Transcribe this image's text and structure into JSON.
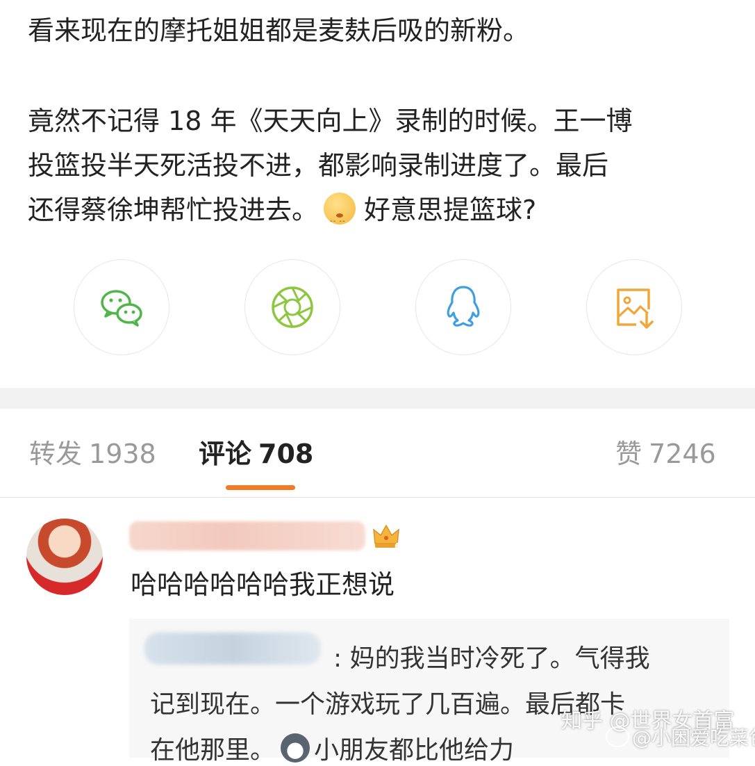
{
  "post": {
    "line1": "看来现在的摩托姐姐都是麦麸后吸的新粉。",
    "para2_line1": "竟然不记得 18 年《天天向上》录制的时候。王一博",
    "para2_line2": "投篮投半天死活投不进，都影响录制进度了。最后",
    "para2_line3_a": "还得蔡徐坤帮忙投进去。",
    "para2_line3_b": "好意思提篮球?"
  },
  "share_buttons": [
    {
      "icon": "wechat-icon",
      "color": "#4cb648"
    },
    {
      "icon": "moments-icon",
      "color": "#8dc63f"
    },
    {
      "icon": "qq-icon",
      "color": "#3d9fe0"
    },
    {
      "icon": "save-image-icon",
      "color": "#f0a73a"
    }
  ],
  "tabs": {
    "repost_label": "转发",
    "repost_count": "1938",
    "comment_label": "评论",
    "comment_count": "708",
    "like_label": "赞",
    "like_count": "7246"
  },
  "comment": {
    "text": "哈哈哈哈哈哈我正想说",
    "badge_level": "6",
    "reply": {
      "line1": ": 妈的我当时冷死了。气得我",
      "line2": "记到现在。一个游戏玩了几百遍。最后都卡",
      "line3_a": "在他那里。",
      "line3_b": "小朋友都比他给力"
    }
  },
  "watermark": {
    "line1": "知乎 @世界女首富",
    "line2": "@小困爱吃菜包"
  },
  "colors": {
    "accent": "#f07a26",
    "text": "#222222",
    "muted": "#999999"
  }
}
